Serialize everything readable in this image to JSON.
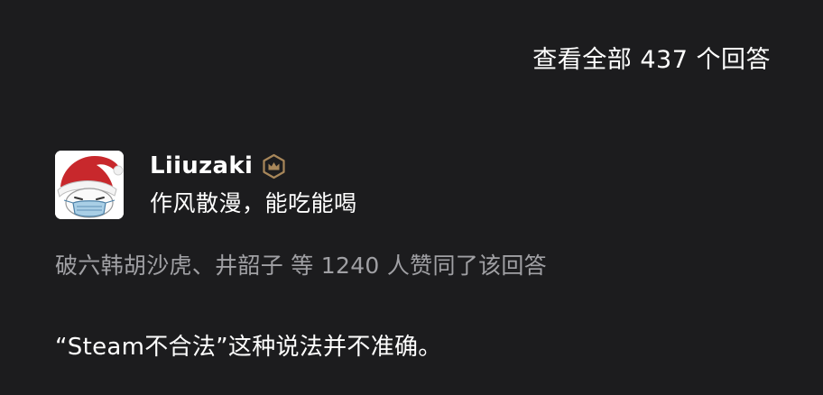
{
  "header": {
    "view_all_answers": "查看全部 437 个回答"
  },
  "author": {
    "avatar_icon": "santa-hat-mask-avatar",
    "name": "Liiuzaki",
    "badge_icon": "crown-badge-icon",
    "badge_color": "#a8875a",
    "bio": "作风散漫，能吃能喝"
  },
  "answer": {
    "likes_text": "破六韩胡沙虎、井韶子 等 1240 人赞同了该回答",
    "first_line": "“Steam不合法”这种说法并不准确。"
  }
}
